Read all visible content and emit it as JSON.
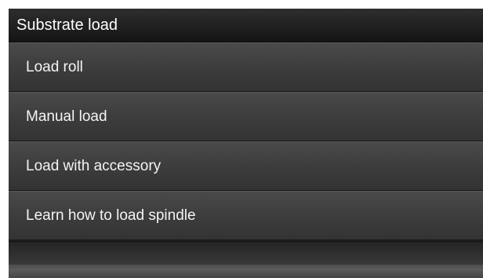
{
  "header": {
    "title": "Substrate load"
  },
  "menu": {
    "items": [
      {
        "label": "Load roll"
      },
      {
        "label": "Manual load"
      },
      {
        "label": "Load with accessory"
      },
      {
        "label": "Learn how to load spindle"
      }
    ]
  },
  "colors": {
    "background": "#1f1f1f",
    "item_top": "#4a4a4a",
    "item_bottom": "#333333",
    "text": "#ffffff"
  }
}
